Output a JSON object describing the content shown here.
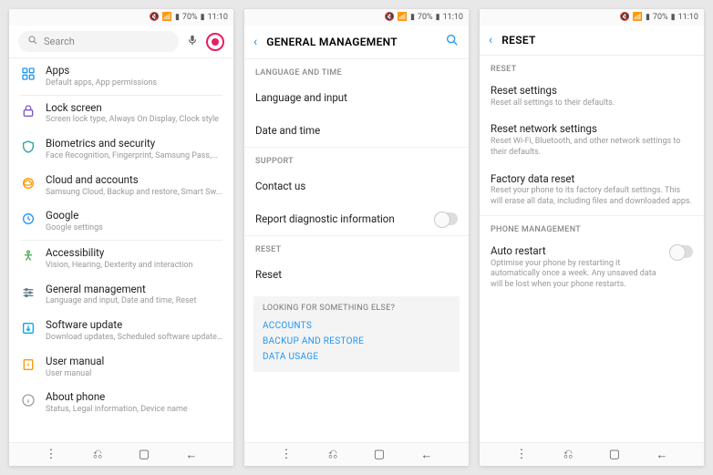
{
  "status": {
    "battery": "70%",
    "time": "11:10"
  },
  "screen1": {
    "search_placeholder": "Search",
    "items": [
      {
        "title": "Apps",
        "sub": "Default apps, App permissions"
      },
      {
        "title": "Lock screen",
        "sub": "Screen lock type, Always On Display, Clock style"
      },
      {
        "title": "Biometrics and security",
        "sub": "Face Recognition, Fingerprint, Samsung Pass,..."
      },
      {
        "title": "Cloud and accounts",
        "sub": "Samsung Cloud, Backup and restore, Smart Sw..."
      },
      {
        "title": "Google",
        "sub": "Google settings"
      },
      {
        "title": "Accessibility",
        "sub": "Vision, Hearing, Dexterity and interaction"
      },
      {
        "title": "General management",
        "sub": "Language and input, Date and time, Reset"
      },
      {
        "title": "Software update",
        "sub": "Download updates, Scheduled software update..."
      },
      {
        "title": "User manual",
        "sub": "User manual"
      },
      {
        "title": "About phone",
        "sub": "Status, Legal information, Device name"
      }
    ]
  },
  "screen2": {
    "title": "GENERAL MANAGEMENT",
    "sections": {
      "lang_header": "LANGUAGE AND TIME",
      "lang_items": [
        "Language and input",
        "Date and time"
      ],
      "support_header": "SUPPORT",
      "contact": "Contact us",
      "report": "Report diagnostic information",
      "reset_header": "RESET",
      "reset": "Reset"
    },
    "suggest": {
      "header": "LOOKING FOR SOMETHING ELSE?",
      "links": [
        "ACCOUNTS",
        "BACKUP AND RESTORE",
        "DATA USAGE"
      ]
    }
  },
  "screen3": {
    "title": "RESET",
    "reset_header": "RESET",
    "items": [
      {
        "title": "Reset settings",
        "sub": "Reset all settings to their defaults."
      },
      {
        "title": "Reset network settings",
        "sub": "Reset Wi-Fi, Bluetooth, and other network settings to their defaults."
      },
      {
        "title": "Factory data reset",
        "sub": "Reset your phone to its factory default settings. This will erase all data, including files and downloaded apps."
      }
    ],
    "pm_header": "PHONE MANAGEMENT",
    "auto": {
      "title": "Auto restart",
      "sub": "Optimise your phone by restarting it automatically once a week. Any unsaved data will be lost when your phone restarts."
    }
  }
}
